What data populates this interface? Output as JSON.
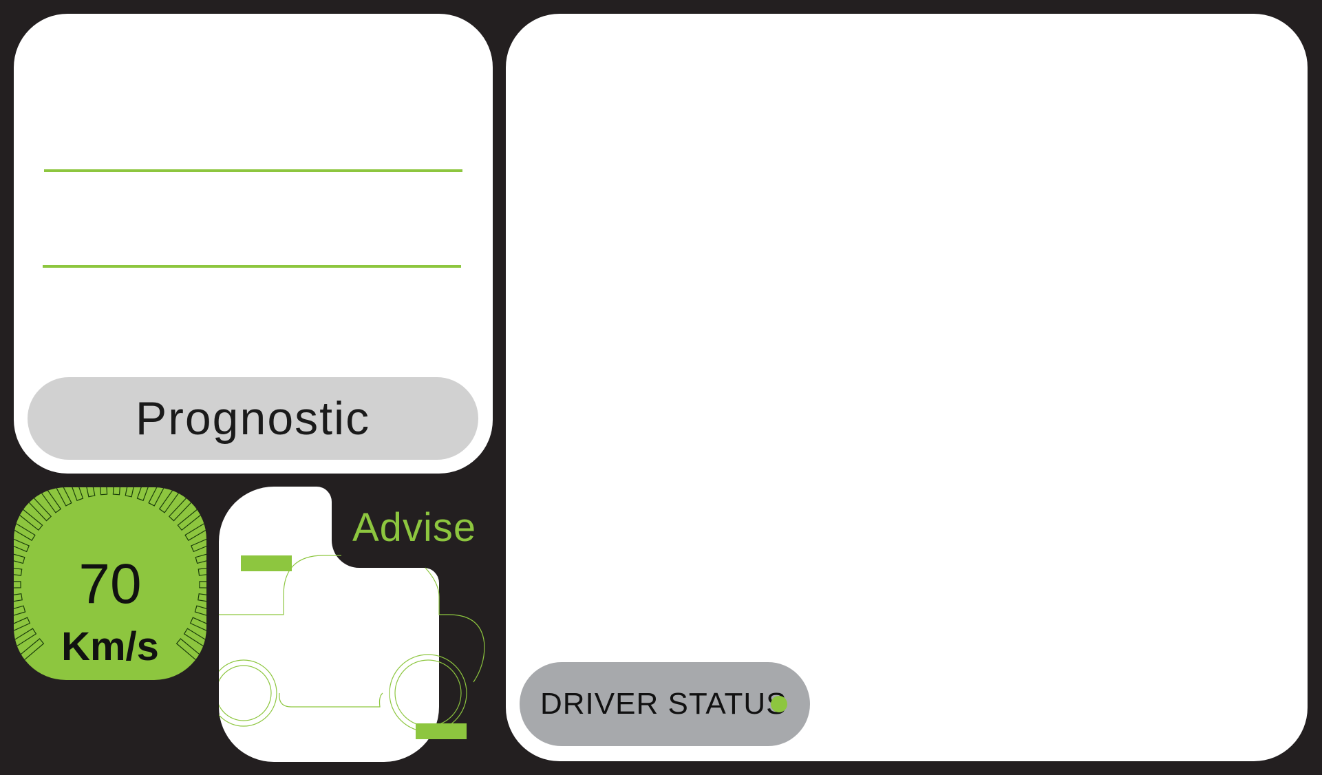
{
  "prognostic": {
    "label": "Prognostic"
  },
  "speed": {
    "value": "70",
    "unit": "Km/s"
  },
  "advise": {
    "label": "Advise"
  },
  "driver_status": {
    "label": "DRIVER STATUS",
    "indicator_color": "#8dc63f"
  },
  "colors": {
    "background": "#231f20",
    "accent": "#8dc63f",
    "panel": "#ffffff",
    "pill_light": "#d1d1d1",
    "pill_dark": "#a7a9ac"
  }
}
